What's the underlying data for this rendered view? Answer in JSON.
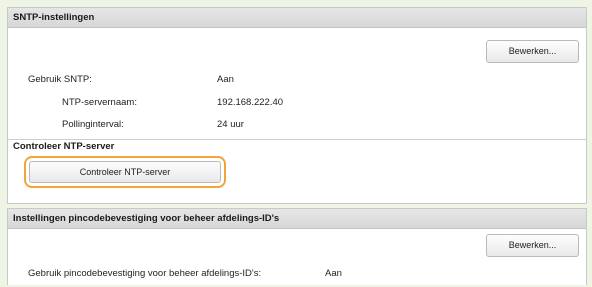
{
  "sntp": {
    "header": "SNTP-instellingen",
    "edit_button": "Bewerken...",
    "rows": [
      {
        "label": "Gebruik SNTP:",
        "value": "Aan"
      },
      {
        "label": "NTP-servernaam:",
        "value": "192.168.222.40"
      },
      {
        "label": "Pollinginterval:",
        "value": "24 uur"
      }
    ],
    "check_section_title": "Controleer NTP-server",
    "check_button": "Controleer NTP-server"
  },
  "pin": {
    "header": "Instellingen pincodebevestiging voor beheer afdelings-ID's",
    "edit_button": "Bewerken...",
    "rows": [
      {
        "label": "Gebruik pincodebevestiging voor beheer afdelings-ID's:",
        "value": "Aan"
      }
    ]
  },
  "colors": {
    "background": "#eef5e4",
    "highlight": "#f3a33a"
  }
}
